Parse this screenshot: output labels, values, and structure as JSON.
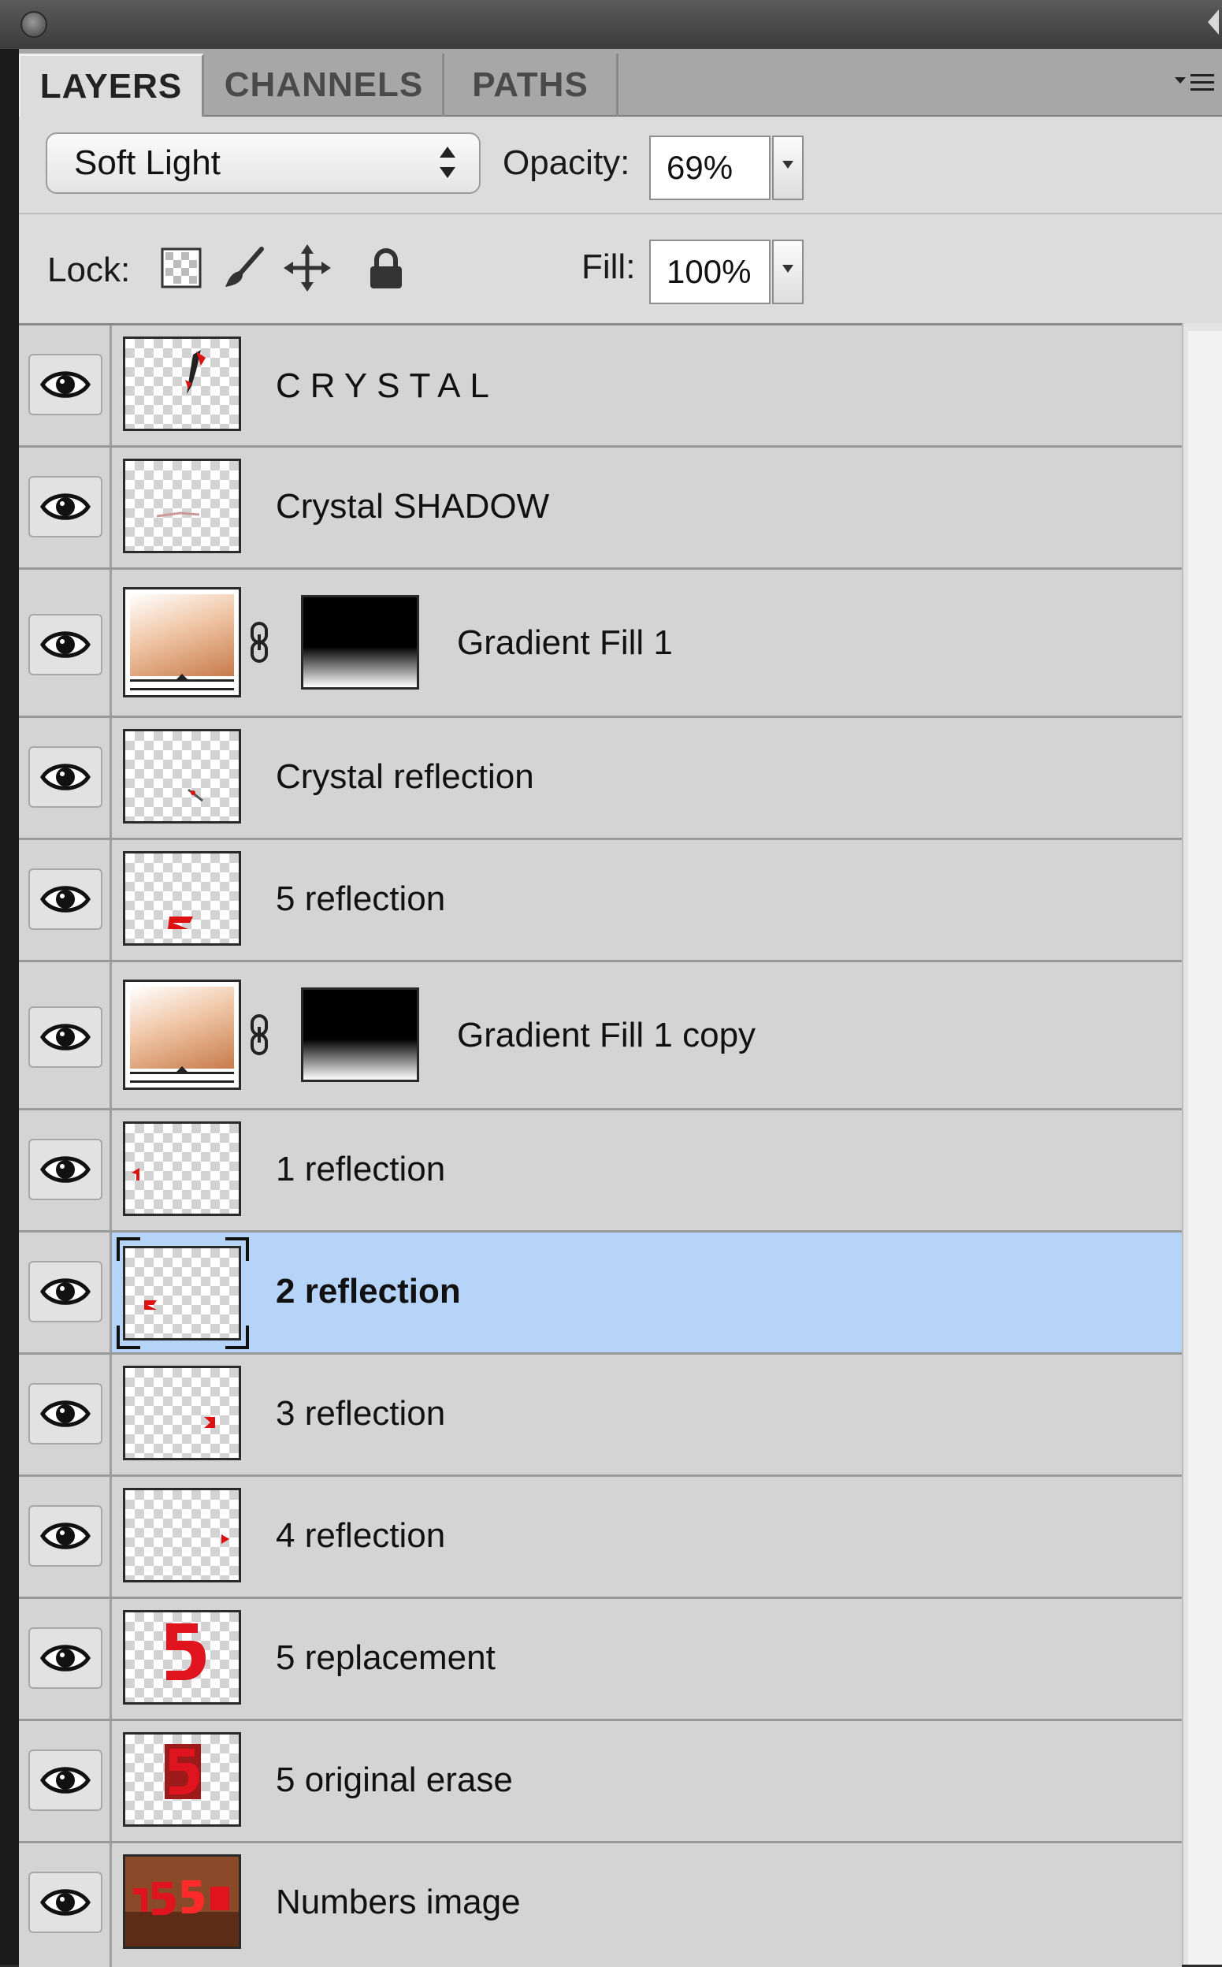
{
  "tabs": [
    {
      "label": "LAYERS",
      "active": true
    },
    {
      "label": "CHANNELS",
      "active": false
    },
    {
      "label": "PATHS",
      "active": false
    }
  ],
  "options": {
    "blend_mode": "Soft Light",
    "opacity_label": "Opacity:",
    "opacity_value": "69%",
    "lock_label": "Lock:",
    "fill_label": "Fill:",
    "fill_value": "100%"
  },
  "layers": [
    {
      "name": "CRYSTAL",
      "type": "pixel",
      "visible": true,
      "selected": false
    },
    {
      "name": "Crystal  SHADOW",
      "type": "pixel",
      "visible": true,
      "selected": false
    },
    {
      "name": "Gradient Fill 1",
      "type": "gradient-fill",
      "visible": true,
      "selected": false
    },
    {
      "name": "Crystal reflection",
      "type": "pixel",
      "visible": true,
      "selected": false
    },
    {
      "name": "5  reflection",
      "type": "pixel",
      "visible": true,
      "selected": false
    },
    {
      "name": "Gradient Fill 1 copy",
      "type": "gradient-fill",
      "visible": true,
      "selected": false
    },
    {
      "name": "1  reflection",
      "type": "pixel",
      "visible": true,
      "selected": false
    },
    {
      "name": "2  reflection",
      "type": "pixel",
      "visible": true,
      "selected": true
    },
    {
      "name": "3  reflection",
      "type": "pixel",
      "visible": true,
      "selected": false
    },
    {
      "name": "4  reflection",
      "type": "pixel",
      "visible": true,
      "selected": false
    },
    {
      "name": "5 replacement",
      "type": "pixel",
      "visible": true,
      "selected": false
    },
    {
      "name": "5 original erase",
      "type": "pixel",
      "visible": true,
      "selected": false
    },
    {
      "name": "Numbers image",
      "type": "pixel",
      "visible": true,
      "selected": false
    }
  ],
  "colors": {
    "selection_highlight": "#b6d3f8",
    "panel_background": "#d4d4d4",
    "gradient_accent": "#c77b4a"
  },
  "icons": [
    "close-icon",
    "panel-menu-icon",
    "eye-icon",
    "chain-link-icon",
    "lock-transparency-icon",
    "lock-brush-icon",
    "lock-move-icon",
    "lock-all-icon"
  ]
}
